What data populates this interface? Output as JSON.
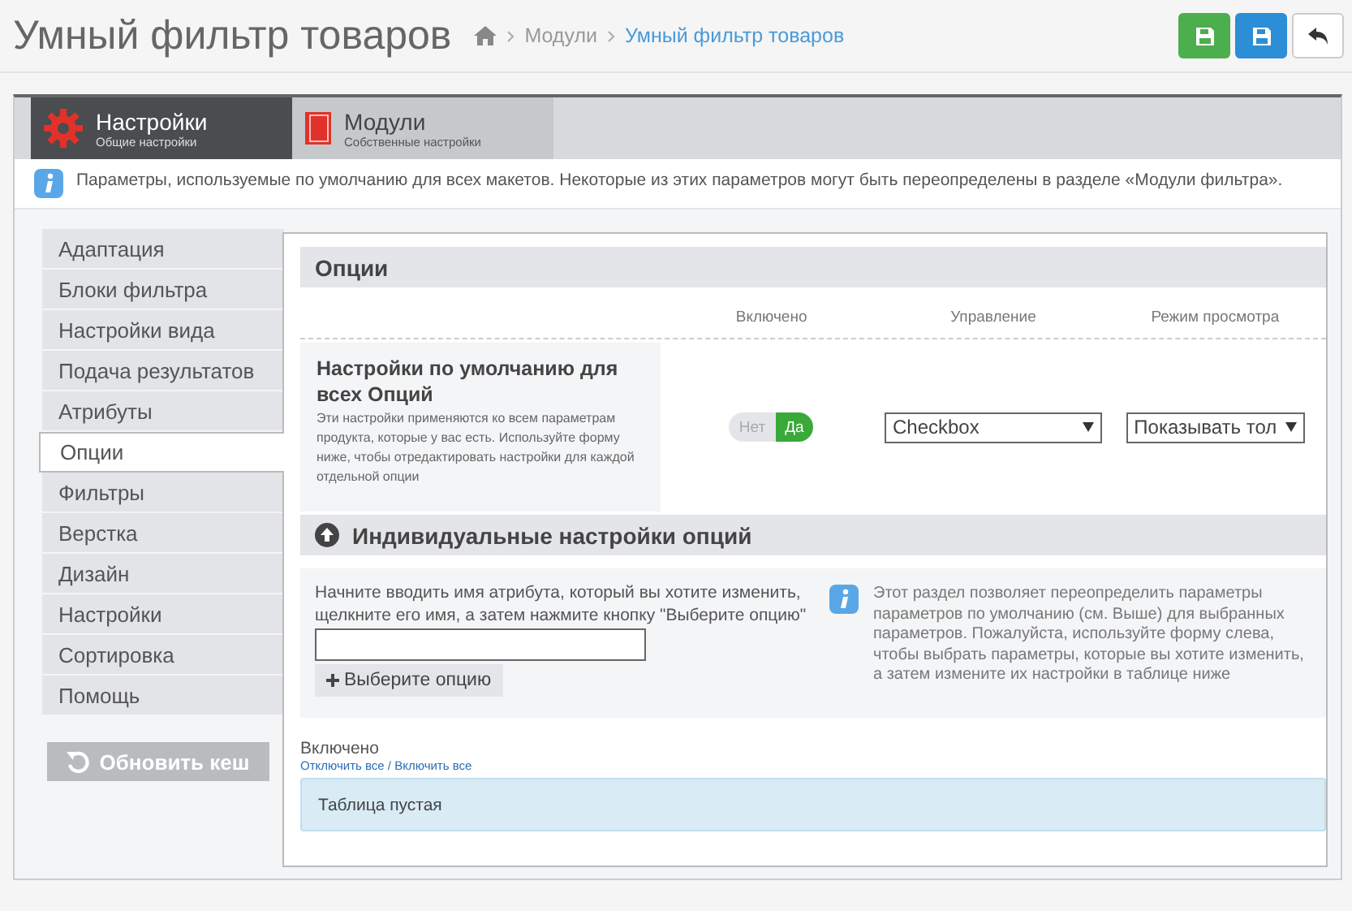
{
  "header": {
    "title": "Умный фильтр товаров",
    "breadcrumb": [
      {
        "label": "Модули",
        "current": false
      },
      {
        "label": "Умный фильтр товаров",
        "current": true
      }
    ],
    "buttons": [
      {
        "kind": "save"
      },
      {
        "kind": "save-stay"
      },
      {
        "kind": "back"
      }
    ]
  },
  "tabs": [
    {
      "title": "Настройки",
      "subtitle": "Общие настройки",
      "kind": "gear",
      "selected": true
    },
    {
      "title": "Модули",
      "subtitle": "Собственные настройки",
      "kind": "book",
      "selected": false
    }
  ],
  "info": "Параметры, используемые по умолчанию для всех макетов. Некоторые из этих параметров могут быть переопределены в разделе «Модули фильтра».",
  "sidebar": {
    "items": [
      {
        "label": "Адаптация",
        "selected": false
      },
      {
        "label": "Блоки фильтра",
        "selected": false
      },
      {
        "label": "Настройки вида",
        "selected": false
      },
      {
        "label": "Подача результатов",
        "selected": false
      },
      {
        "label": "Атрибуты",
        "selected": false
      },
      {
        "label": "Опции",
        "selected": true
      },
      {
        "label": "Фильтры",
        "selected": false
      },
      {
        "label": "Верстка",
        "selected": false
      },
      {
        "label": "Дизайн",
        "selected": false
      },
      {
        "label": "Настройки",
        "selected": false
      },
      {
        "label": "Сортировка",
        "selected": false
      },
      {
        "label": "Помощь",
        "selected": false
      }
    ],
    "refresh_button": "Обновить кеш"
  },
  "content": {
    "title": "Опции",
    "columns": [
      "Включено",
      "Управление",
      "Режим просмотра"
    ],
    "default_row": {
      "title": "Настройки по умолчанию для всех Опций",
      "description": "Эти настройки применяются ко всем параметрам продукта, которые у вас есть. Используйте форму ниже, чтобы отредактировать настройки для каждой отдельной опции",
      "toggle": [
        {
          "label": "Нет",
          "selected": false
        },
        {
          "label": "Да",
          "selected": true
        }
      ],
      "control": "Checkbox",
      "view_mode": "Показывать тол"
    },
    "individual": {
      "title": "Индивидуальные настройки опций",
      "expanded": true,
      "hint": "Начните вводить имя атрибута, который вы хотите изменить, щелкните его имя, а затем нажмите кнопку \"Выберите опцию\"",
      "button": "Выберите опцию",
      "note": "Этот раздел позволяет переопределить параметры параметров по умолчанию (см. Выше) для выбранных параметров. Пожалуйста, используйте форму слева, чтобы выбрать параметры, которые вы хотите изменить, а затем измените их настройки в таблице ниже"
    },
    "enabled_label": "Включено",
    "links": [
      "Отключить все",
      "Включить все"
    ],
    "link_separator": "/",
    "empty": "Таблица пустая"
  }
}
